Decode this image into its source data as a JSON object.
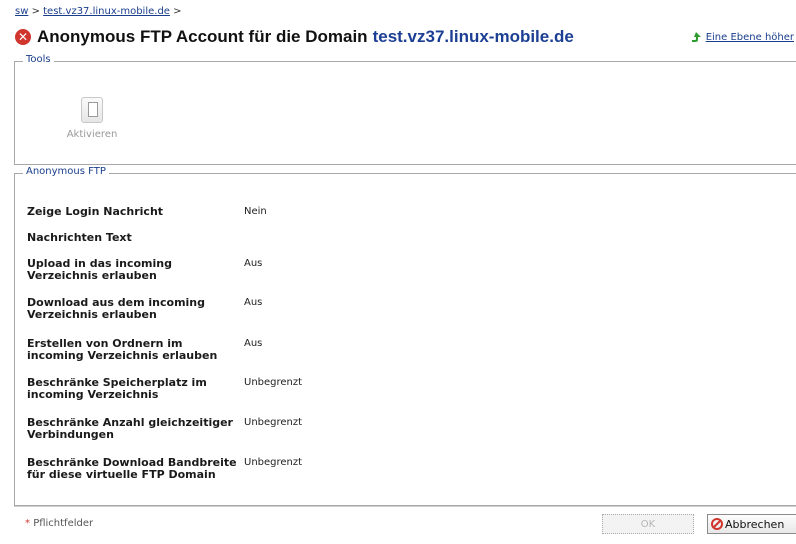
{
  "breadcrumb": {
    "root": "sw",
    "domain": "test.vz37.linux-mobile.de",
    "sep1": " > ",
    "sep2": " >"
  },
  "header": {
    "title": "Anonymous FTP Account für die Domain",
    "domain": "test.vz37.linux-mobile.de",
    "up_link": "Eine Ebene höher",
    "icons": {
      "status": "error-icon",
      "up": "up-arrow-icon"
    }
  },
  "tools": {
    "legend": "Tools",
    "activate_label": "Aktivieren",
    "activate_icon": "device-activate-icon"
  },
  "ftp": {
    "legend": "Anonymous FTP",
    "rows": [
      {
        "label": "Zeige Login Nachricht",
        "value": "Nein"
      },
      {
        "label": "Nachrichten Text",
        "value": ""
      },
      {
        "label": "Upload in das incoming Verzeichnis erlauben",
        "value": "Aus"
      },
      {
        "label": "Download aus dem incoming Verzeichnis erlauben",
        "value": "Aus"
      },
      {
        "label": "Erstellen von Ordnern im incoming Verzeichnis erlauben",
        "value": "Aus"
      },
      {
        "label": "Beschränke Speicherplatz im incoming Verzeichnis",
        "value": "Unbegrenzt"
      },
      {
        "label": "Beschränke Anzahl gleichzeitiger Verbindungen",
        "value": "Unbegrenzt"
      },
      {
        "label": "Beschränke Download Bandbreite für diese virtuelle FTP Domain",
        "value": "Unbegrenzt"
      }
    ]
  },
  "footer": {
    "required_star": "*",
    "required_label": "Pflichtfelder",
    "ok_label": "OK",
    "cancel_label": "Abbrechen",
    "cancel_icon": "cancel-icon"
  },
  "colors": {
    "link": "#1a3e8c",
    "error": "#d0352e",
    "domain": "#1c3f94"
  }
}
